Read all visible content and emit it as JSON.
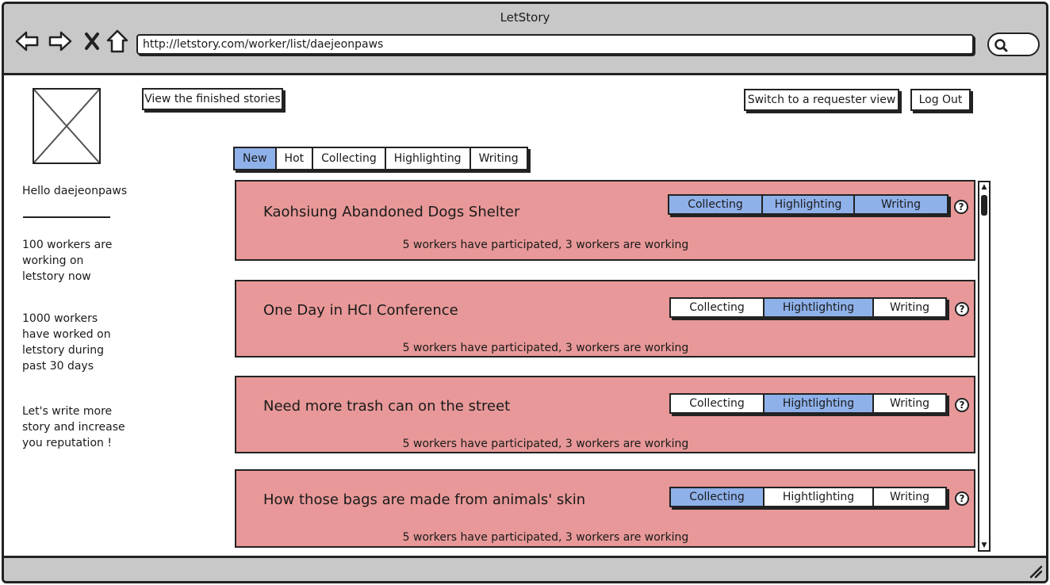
{
  "window": {
    "title": "LetStory"
  },
  "browser": {
    "url": "http://letstory.com/worker/list/daejeonpaws",
    "icons": [
      "back-arrow-icon",
      "forward-arrow-icon",
      "close-icon",
      "home-icon",
      "search-icon"
    ]
  },
  "header": {
    "finished_stories": "View the finished stories",
    "switch_view": "Switch to a requester view",
    "logout": "Log Out"
  },
  "sidebar": {
    "greeting": "Hello daejeonpaws",
    "stat1_lines": [
      "100 workers are",
      "working on",
      "letstory now"
    ],
    "stat2_lines": [
      "1000 workers",
      "have worked on",
      "letstory during",
      "past 30 days"
    ],
    "motto_lines": [
      "Let's write more",
      "story and increase",
      "you reputation !"
    ]
  },
  "tabs": [
    {
      "label": "New",
      "active": true
    },
    {
      "label": "Hot",
      "active": false
    },
    {
      "label": "Collecting",
      "active": false
    },
    {
      "label": "Highlighting",
      "active": false
    },
    {
      "label": "Writing",
      "active": false
    }
  ],
  "stories": [
    {
      "title": "Kaohsiung Abandoned Dogs Shelter",
      "status": "5 workers have participated, 3 workers are working",
      "stages": [
        {
          "label": "Collecting",
          "active": true
        },
        {
          "label": "Highlighting",
          "active": true
        },
        {
          "label": "Writing",
          "active": true
        }
      ]
    },
    {
      "title": "One Day in HCI Conference",
      "status": "5 workers have participated, 3 workers are working",
      "stages": [
        {
          "label": "Collecting",
          "active": false
        },
        {
          "label": "Hightlighting",
          "active": true
        },
        {
          "label": "Writing",
          "active": false
        }
      ]
    },
    {
      "title": "Need more trash can on the street",
      "status": "5 workers have participated, 3 workers are working",
      "stages": [
        {
          "label": "Collecting",
          "active": false
        },
        {
          "label": "Hightlighting",
          "active": true
        },
        {
          "label": "Writing",
          "active": false
        }
      ]
    },
    {
      "title": "How those bags are made from animals' skin",
      "status": "5 workers have participated, 3 workers are working",
      "stages": [
        {
          "label": "Collecting",
          "active": true
        },
        {
          "label": "Hightlighting",
          "active": false
        },
        {
          "label": "Writing",
          "active": false
        }
      ]
    }
  ],
  "help_label": "?",
  "colors": {
    "card": "#e89898",
    "active": "#8fb1ea",
    "chrome": "#c8c8c8"
  }
}
